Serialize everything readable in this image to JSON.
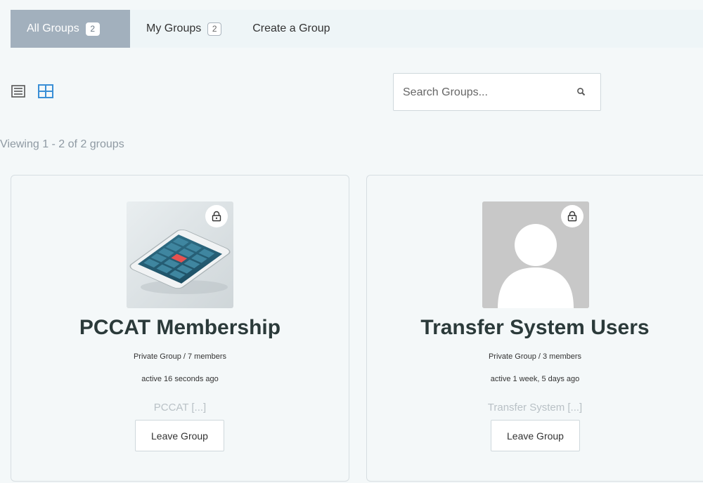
{
  "tabs": [
    {
      "label": "All Groups",
      "count": "2"
    },
    {
      "label": "My Groups",
      "count": "2"
    },
    {
      "label": "Create a Group"
    }
  ],
  "view_toggles": {
    "list_icon": "list-view-icon",
    "grid_icon": "grid-view-icon"
  },
  "search": {
    "placeholder": "Search Groups...",
    "value": "",
    "icon": "search-icon"
  },
  "viewing_text": "Viewing 1 - 2 of 2 groups",
  "groups": [
    {
      "name": "PCCAT Membership",
      "meta": "Private Group / 7 members",
      "active": "active 16 seconds ago",
      "description": "PCCAT [...]",
      "button": "Leave Group",
      "lock_icon": "lock-icon"
    },
    {
      "name": "Transfer System Users",
      "meta": "Private Group / 3 members",
      "active": "active 1 week, 5 days ago",
      "description": "Transfer System [...]",
      "button": "Leave Group",
      "lock_icon": "lock-icon"
    }
  ],
  "colors": {
    "active_tab": "#a2b0bd",
    "accent_blue": "#3a8fd6",
    "background": "#f4f8f9"
  }
}
